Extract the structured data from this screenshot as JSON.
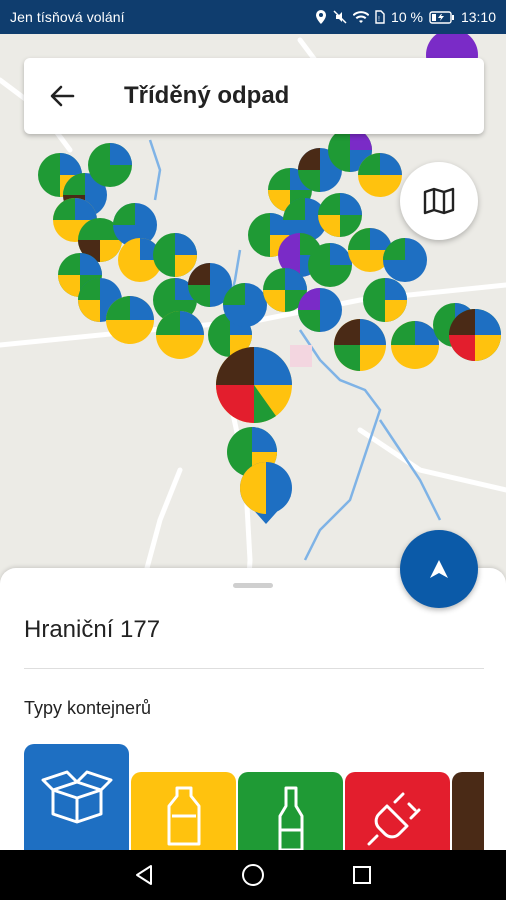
{
  "status_bar": {
    "carrier_text": "Jen tísňová volání",
    "battery_text": "10 %",
    "time": "13:10"
  },
  "header": {
    "title": "Tříděný odpad"
  },
  "map": {
    "colors": {
      "paper": "#1e6fc2",
      "plastic": "#ffc20e",
      "glass": "#1f9a35",
      "electro": "#e31e2d",
      "bio": "#4a2a16",
      "textile": "#7a2bc7"
    }
  },
  "bottom_sheet": {
    "address": "Hraniční 177",
    "types_label": "Typy kontejnerů",
    "container_types": [
      {
        "name": "paper",
        "icon": "paper-box-icon",
        "color": "#1e6fc2"
      },
      {
        "name": "plastic",
        "icon": "plastic-bottle-icon",
        "color": "#ffc20e"
      },
      {
        "name": "glass",
        "icon": "glass-bottle-icon",
        "color": "#1f9a35"
      },
      {
        "name": "electro",
        "icon": "electric-plug-icon",
        "color": "#e31e2d"
      },
      {
        "name": "bio",
        "icon": "bio-waste-icon",
        "color": "#4a2a16"
      }
    ]
  }
}
